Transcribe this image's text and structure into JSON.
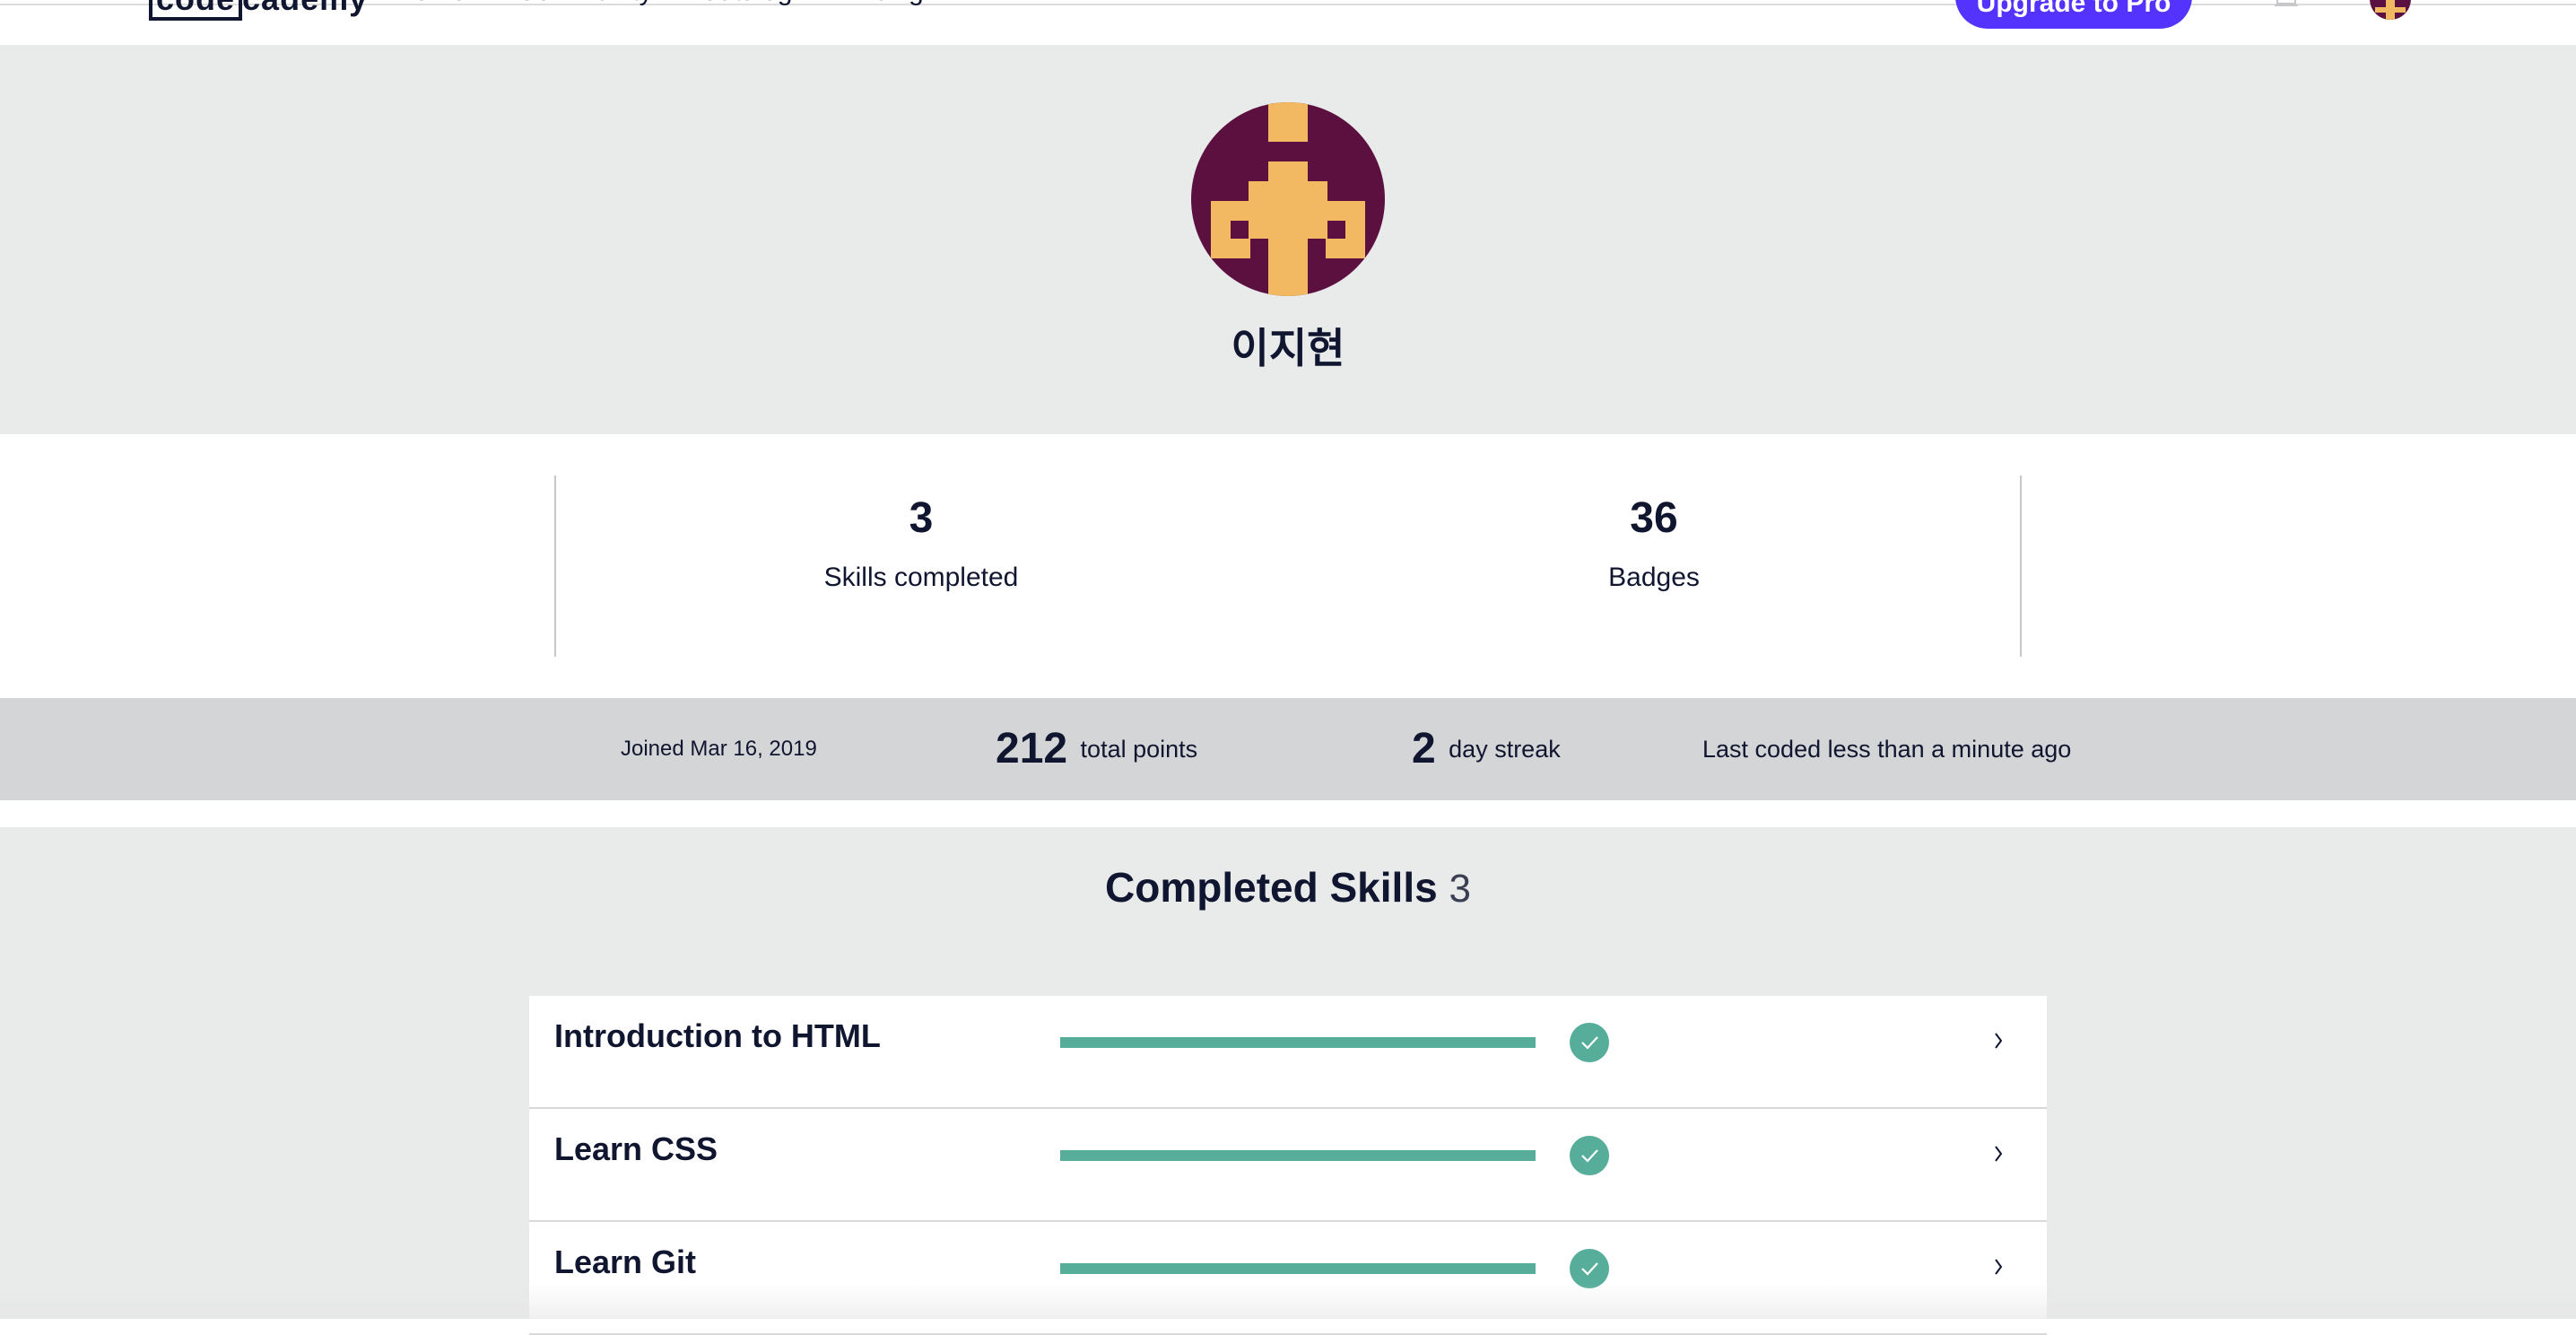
{
  "nav": {
    "logo_a": "code",
    "logo_b": "cademy",
    "links": [
      "Home",
      "Community",
      "Catalog",
      "Pricing"
    ],
    "upgrade_label": "Upgrade to Pro"
  },
  "profile": {
    "username": "이지현",
    "avatar_colors": {
      "background": "#5c1040",
      "pattern": "#f2b962"
    }
  },
  "stats": [
    {
      "value": "3",
      "label": "Skills completed"
    },
    {
      "value": "36",
      "label": "Badges"
    }
  ],
  "summary": {
    "joined": "Joined Mar 16, 2019",
    "points_value": "212",
    "points_label": "total points",
    "streak_value": "2",
    "streak_label": "day streak",
    "last_coded": "Last coded less than a minute ago"
  },
  "skills": {
    "title": "Completed Skills",
    "count": "3",
    "items": [
      {
        "name": "Introduction to HTML",
        "progress": 1.0
      },
      {
        "name": "Learn CSS",
        "progress": 1.0
      },
      {
        "name": "Learn Git",
        "progress": 1.0
      }
    ]
  },
  "colors": {
    "accent": "#5533ff",
    "progress": "#55ad9a",
    "text": "#10162f"
  }
}
